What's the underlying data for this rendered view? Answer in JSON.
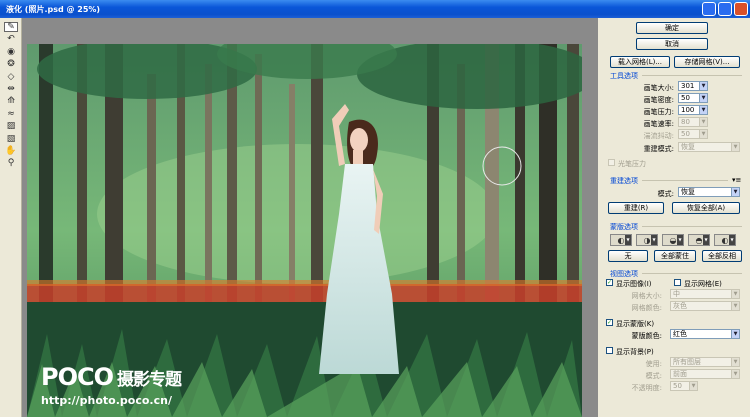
{
  "window": {
    "title": "液化 (照片.psd @ 25%)"
  },
  "toolbox": {
    "tools": [
      {
        "name": "forward-warp-tool",
        "glyph": "✎",
        "active": true
      },
      {
        "name": "reconstruct-tool",
        "glyph": "↶",
        "active": false
      },
      {
        "name": "twirl-tool",
        "glyph": "◉",
        "active": false
      },
      {
        "name": "pucker-tool",
        "glyph": "❂",
        "active": false
      },
      {
        "name": "bloat-tool",
        "glyph": "◇",
        "active": false
      },
      {
        "name": "push-left-tool",
        "glyph": "⇹",
        "active": false
      },
      {
        "name": "mirror-tool",
        "glyph": "⟰",
        "active": false
      },
      {
        "name": "turbulence-tool",
        "glyph": "≈",
        "active": false
      },
      {
        "name": "freeze-mask-tool",
        "glyph": "▨",
        "active": false
      },
      {
        "name": "thaw-mask-tool",
        "glyph": "▧",
        "active": false
      },
      {
        "name": "hand-tool",
        "glyph": "✋",
        "active": false
      },
      {
        "name": "zoom-tool",
        "glyph": "⚲",
        "active": false
      }
    ]
  },
  "watermark": {
    "brand": "POCO",
    "slogan": "摄影专题",
    "url": "http://photo.poco.cn/"
  },
  "panel": {
    "ok": "确定",
    "cancel": "取消",
    "load_mesh": "载入网格(L)...",
    "save_mesh": "存储网格(V)...",
    "tool_options": {
      "title": "工具选项",
      "brush_size": {
        "label": "画笔大小:",
        "value": "301"
      },
      "brush_density": {
        "label": "画笔密度:",
        "value": "50"
      },
      "brush_pressure": {
        "label": "画笔压力:",
        "value": "100"
      },
      "brush_rate": {
        "label": "画笔速率:",
        "value": "80"
      },
      "turbulent_jitter": {
        "label": "湍流抖动:",
        "value": "50"
      },
      "reconstruct_mode": {
        "label": "重建模式:",
        "value": "恢复"
      },
      "stylus_pressure": "光笔压力"
    },
    "reconstruct_options": {
      "title": "重建选项",
      "mode_label": "模式:",
      "mode_value": "恢复",
      "reconstruct_button": "重建(R)",
      "restore_all_button": "恢复全部(A)"
    },
    "mask_options": {
      "title": "蒙版选项",
      "none_button": "无",
      "mask_all_button": "全部蒙住",
      "invert_all_button": "全部反相"
    },
    "view_options": {
      "title": "视图选项",
      "show_image": "显示图像(I)",
      "show_image_checked": true,
      "show_mesh": "显示网格(E)",
      "show_mesh_checked": false,
      "mesh_size_label": "网格大小:",
      "mesh_size_value": "中",
      "mesh_color_label": "网格颜色:",
      "mesh_color_value": "灰色",
      "show_mask": "显示蒙版(K)",
      "show_mask_checked": true,
      "mask_color_label": "蒙版颜色:",
      "mask_color_value": "红色",
      "show_backdrop": "显示背景(P)",
      "show_backdrop_checked": false,
      "use_label": "使用:",
      "use_value": "所有图层",
      "mode_label": "模式:",
      "mode_value": "前面",
      "opacity_label": "不透明度:",
      "opacity_value": "50"
    }
  }
}
